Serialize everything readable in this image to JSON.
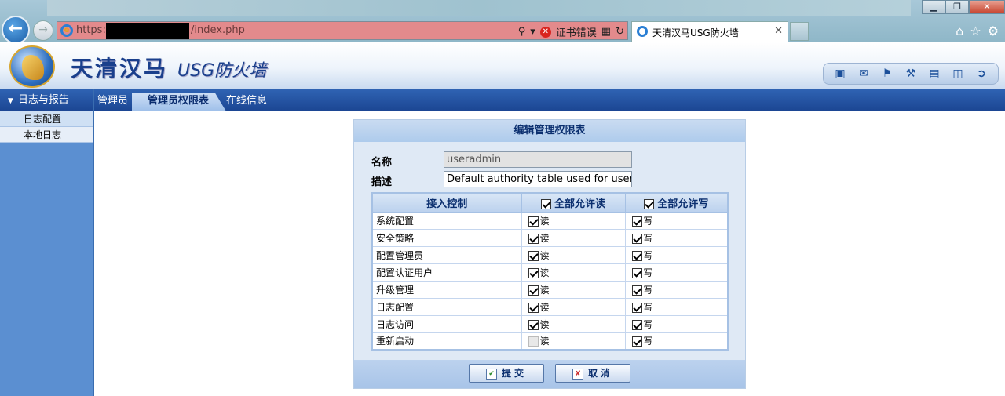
{
  "browser": {
    "url_prefix": "https:/",
    "url_path": "/index.php",
    "cert_error": "证书错误",
    "tab_title": "天清汉马USG防火墙"
  },
  "header": {
    "brand": "天清汉马",
    "product": "USG防火墙"
  },
  "sidebar": {
    "section": "日志与报告",
    "items": [
      {
        "label": "日志配置"
      },
      {
        "label": "本地日志"
      }
    ]
  },
  "nav": {
    "tabs": [
      {
        "label": "管理员"
      },
      {
        "label": "管理员权限表"
      },
      {
        "label": "在线信息"
      }
    ]
  },
  "form": {
    "title": "编辑管理权限表",
    "name_label": "名称",
    "name_value": "useradmin",
    "desc_label": "描述",
    "desc_value": "Default authority table used for useradm",
    "table": {
      "col_access": "接入控制",
      "col_read_all": "全部允许读",
      "col_write_all": "全部允许写",
      "read_label": "读",
      "write_label": "写",
      "rows": [
        {
          "name": "系统配置",
          "read": true,
          "write": true
        },
        {
          "name": "安全策略",
          "read": true,
          "write": true
        },
        {
          "name": "配置管理员",
          "read": true,
          "write": true
        },
        {
          "name": "配置认证用户",
          "read": true,
          "write": true
        },
        {
          "name": "升级管理",
          "read": true,
          "write": true
        },
        {
          "name": "日志配置",
          "read": true,
          "write": true
        },
        {
          "name": "日志访问",
          "read": true,
          "write": true
        },
        {
          "name": "重新启动",
          "read": false,
          "write": true
        }
      ]
    },
    "submit_label": "提交",
    "cancel_label": "取消"
  }
}
